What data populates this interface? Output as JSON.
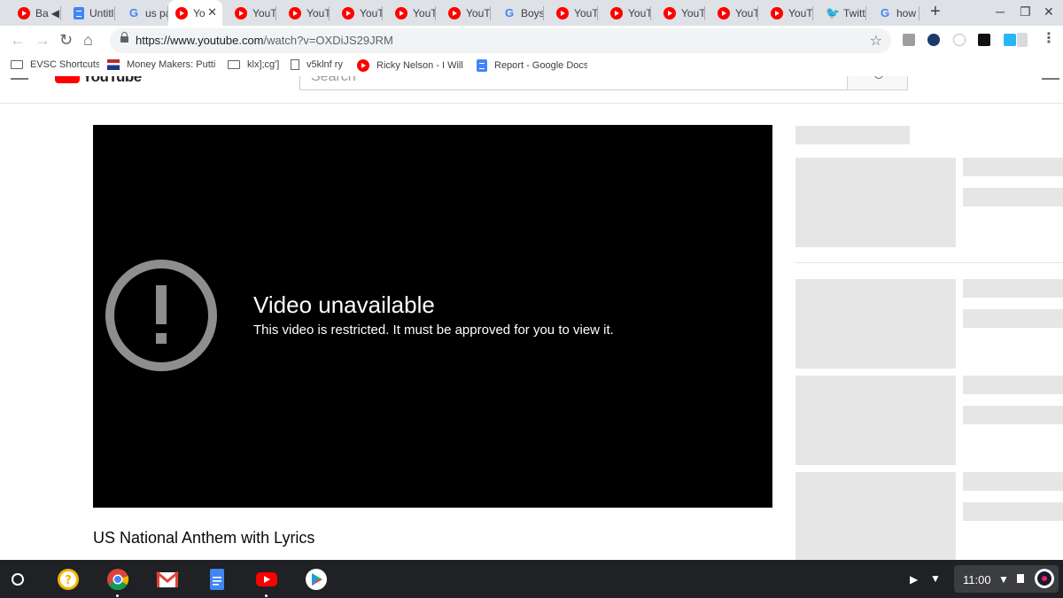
{
  "browser": {
    "tabs": [
      {
        "title": "Ba",
        "favicon": "youtube-icon",
        "audio": true
      },
      {
        "title": "Untitl",
        "favicon": "docs-icon"
      },
      {
        "title": "us pa",
        "favicon": "google-icon"
      },
      {
        "title": "Yo",
        "favicon": "youtube-icon",
        "active": true
      },
      {
        "title": "YouT",
        "favicon": "youtube-icon"
      },
      {
        "title": "YouT",
        "favicon": "youtube-icon"
      },
      {
        "title": "YouT",
        "favicon": "youtube-icon"
      },
      {
        "title": "YouT",
        "favicon": "youtube-icon"
      },
      {
        "title": "YouT",
        "favicon": "youtube-icon"
      },
      {
        "title": "Boys",
        "favicon": "google-icon"
      },
      {
        "title": "YouT",
        "favicon": "youtube-icon"
      },
      {
        "title": "YouT",
        "favicon": "youtube-icon"
      },
      {
        "title": "YouT",
        "favicon": "youtube-icon"
      },
      {
        "title": "YouT",
        "favicon": "youtube-icon"
      },
      {
        "title": "YouT",
        "favicon": "youtube-icon"
      },
      {
        "title": "Twitt",
        "favicon": "twitter-icon"
      },
      {
        "title": "how t",
        "favicon": "google-icon"
      }
    ],
    "tab_close_glyph": "✕",
    "new_tab_glyph": "+",
    "url": {
      "host": "https://www.youtube.com",
      "path": "/watch?v=OXDiJS29JRM"
    },
    "bookmarks": [
      {
        "label": "EVSC Shortcuts",
        "icon": "folder-icon"
      },
      {
        "label": "Money Makers: Putti",
        "icon": "flag-icon"
      },
      {
        "label": "klx];cg']",
        "icon": "folder-icon"
      },
      {
        "label": "v5klnf ry",
        "icon": "page-icon"
      },
      {
        "label": "Ricky Nelson - I Will F",
        "icon": "youtube-icon"
      },
      {
        "label": "Report - Google Docs",
        "icon": "docs-icon"
      }
    ]
  },
  "youtube": {
    "logo_text": "YouTube",
    "search_placeholder": "Search",
    "player": {
      "error_title": "Video unavailable",
      "error_message": "This video is restricted. It must be approved for you to view it."
    },
    "video_title": "US National Anthem with Lyrics"
  },
  "shelf": {
    "apps": [
      "help-icon",
      "chrome-icon",
      "gmail-icon",
      "docs-icon",
      "youtube-icon",
      "play-store-icon"
    ],
    "time": "11:00"
  },
  "colors": {
    "youtube_red": "#ff0000",
    "shelf_bg": "#202124",
    "skeleton": "#e6e6e6"
  }
}
